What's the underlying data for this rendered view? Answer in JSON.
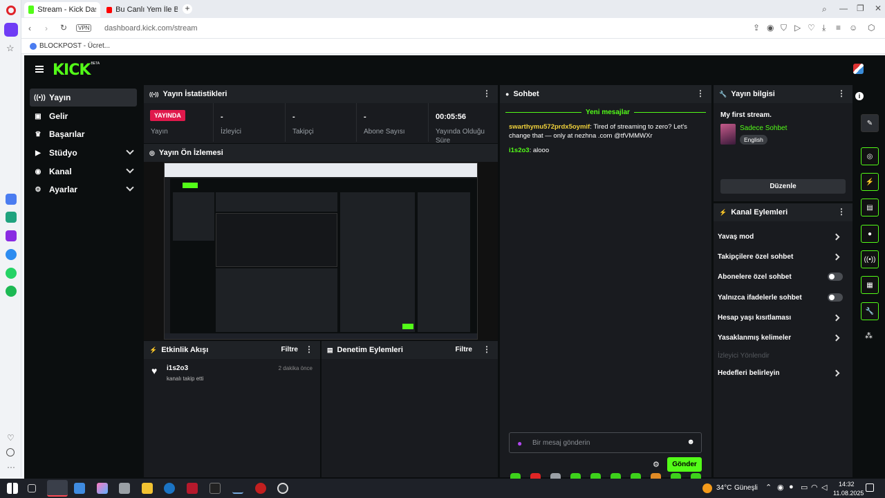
{
  "browser": {
    "tabs": [
      {
        "title": "Stream - Kick Dashboard",
        "active": true
      },
      {
        "title": "Bu Canlı Yem İle Balık Tutu",
        "active": false
      }
    ],
    "address": "dashboard.kick.com/stream",
    "vpn_badge": "VPN",
    "bookmark": "BLOCKPOST - Ücret..."
  },
  "app": {
    "logo": "KICK",
    "logo_badge": "BETA",
    "accent": "#53fc18",
    "nav": [
      {
        "label": "Yayın",
        "icon": "broadcast-icon",
        "active": true,
        "expandable": false
      },
      {
        "label": "Gelir",
        "icon": "wallet-icon",
        "active": false,
        "expandable": false
      },
      {
        "label": "Başarılar",
        "icon": "trophy-icon",
        "active": false,
        "expandable": false
      },
      {
        "label": "Stüdyo",
        "icon": "studio-icon",
        "active": false,
        "expandable": true
      },
      {
        "label": "Kanal",
        "icon": "channel-icon",
        "active": false,
        "expandable": true
      },
      {
        "label": "Ayarlar",
        "icon": "settings-icon",
        "active": false,
        "expandable": true
      }
    ]
  },
  "stats": {
    "title": "Yayın İstatistikleri",
    "live_badge": "YAYINDA",
    "live_label": "Yayın",
    "cells": [
      {
        "value": "-",
        "label": "İzleyici"
      },
      {
        "value": "-",
        "label": "Takipçi"
      },
      {
        "value": "-",
        "label": "Abone Sayısı"
      },
      {
        "value": "00:05:56",
        "label": "Yayında Olduğu Süre"
      }
    ]
  },
  "preview": {
    "title": "Yayın Ön İzlemesi"
  },
  "activity": {
    "title": "Etkinlik Akışı",
    "filter": "Filtre",
    "items": [
      {
        "user": "i1s2o3",
        "text": "kanalı takip etti",
        "time": "2 dakika önce"
      }
    ]
  },
  "moderation": {
    "title": "Denetim Eylemleri",
    "filter": "Filtre"
  },
  "chat": {
    "title": "Sohbet",
    "new_messages": "Yeni mesajlar",
    "messages": [
      {
        "user": "swarthymu572prdx5oymif",
        "user_color": "#f1d23b",
        "text": "Tired of streaming to zero? Let's change that — only at nezhna .com @tfVMMWXr"
      },
      {
        "user": "i1s2o3",
        "user_color": "#53fc18",
        "text": "alooo"
      }
    ],
    "input_placeholder": "Bir mesaj gönderin",
    "send_label": "Gönder"
  },
  "stream_info": {
    "title": "Yayın bilgisi",
    "stream_title": "My first stream.",
    "category": "Sadece Sohbet",
    "language": "English",
    "edit_label": "Düzenle"
  },
  "channel_actions": {
    "title": "Kanal Eylemleri",
    "items": [
      {
        "label": "Yavaş mod",
        "control": "chevron",
        "disabled": false
      },
      {
        "label": "Takipçilere özel sohbet",
        "control": "chevron",
        "disabled": false
      },
      {
        "label": "Abonelere özel sohbet",
        "control": "toggle",
        "disabled": false
      },
      {
        "label": "Yalnızca ifadelerle sohbet",
        "control": "toggle",
        "disabled": false
      },
      {
        "label": "Hesap yaşı kısıtlaması",
        "control": "chevron",
        "disabled": false
      },
      {
        "label": "Yasaklanmış kelimeler",
        "control": "chevron",
        "disabled": false
      },
      {
        "label": "İzleyici Yönlendir",
        "control": "none",
        "disabled": true
      },
      {
        "label": "Hedefleri belirleyin",
        "control": "chevron",
        "disabled": false
      }
    ]
  },
  "taskbar": {
    "weather": "34°C",
    "weather_text": "Güneşli",
    "time": "14:32",
    "date": "11.08.2025"
  }
}
